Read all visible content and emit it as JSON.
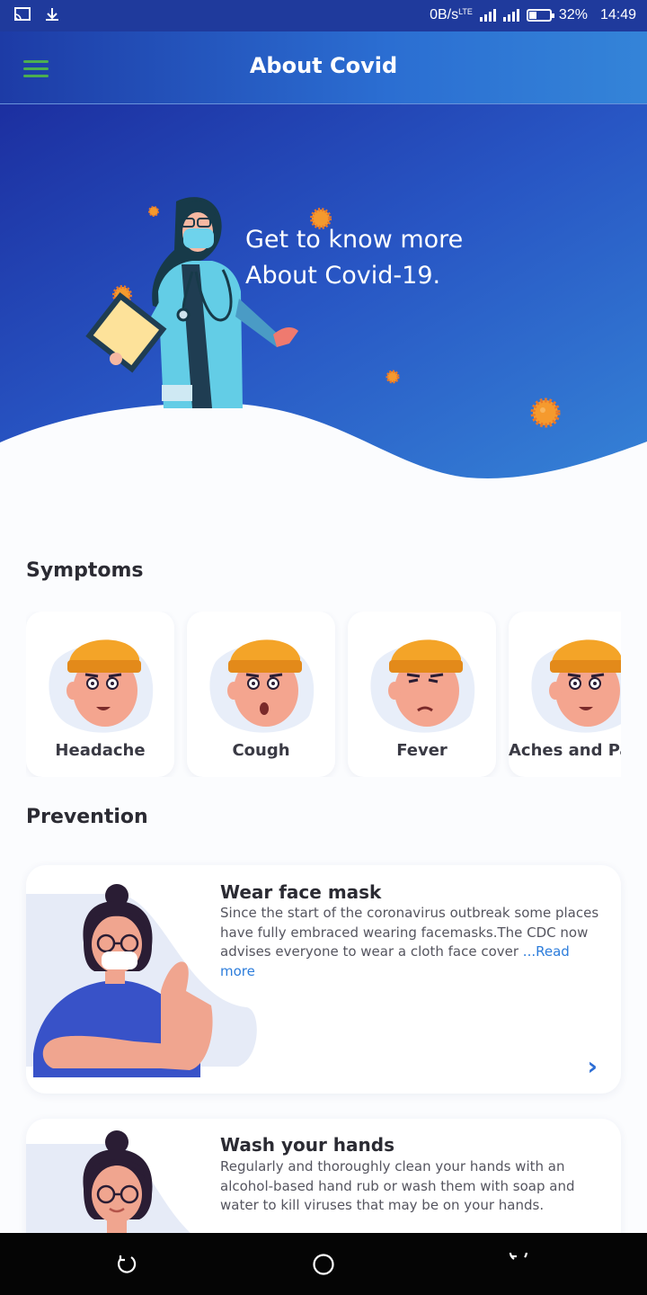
{
  "status_bar": {
    "net_speed": "0B/s",
    "network_type": "LTE",
    "battery": "32%",
    "battery_level": 0.32,
    "time": "14:49",
    "icons": [
      "cast-icon",
      "download-icon",
      "signal-icon",
      "battery-icon"
    ]
  },
  "header": {
    "title": "About Covid",
    "menu_icon": "hamburger-menu-icon",
    "menu_color": "#4caf50"
  },
  "hero": {
    "line1": "Get to know more",
    "line2": "About Covid-19."
  },
  "symptoms": {
    "title": "Symptoms",
    "items": [
      {
        "label": "Headache"
      },
      {
        "label": "Cough"
      },
      {
        "label": "Fever"
      },
      {
        "label": "Aches and Pains"
      }
    ]
  },
  "prevention": {
    "title": "Prevention",
    "items": [
      {
        "title": "Wear face mask",
        "text": "Since the start of the coronavirus outbreak some places have fully embraced wearing facemasks.The CDC now advises everyone to wear a cloth face cover ",
        "read_more": "...Read more"
      },
      {
        "title": "Wash your hands",
        "text": "Regularly and thoroughly clean your hands with an alcohol-based hand rub or wash them with soap and water to kill viruses that may be on your hands."
      }
    ]
  },
  "colors": {
    "primary_blue": "#1d3ba6",
    "accent_blue": "#2d7ddb",
    "virus_orange": "#f59a2e"
  },
  "nav": {
    "buttons": [
      "back-icon",
      "home-icon",
      "recent-apps-icon"
    ]
  }
}
